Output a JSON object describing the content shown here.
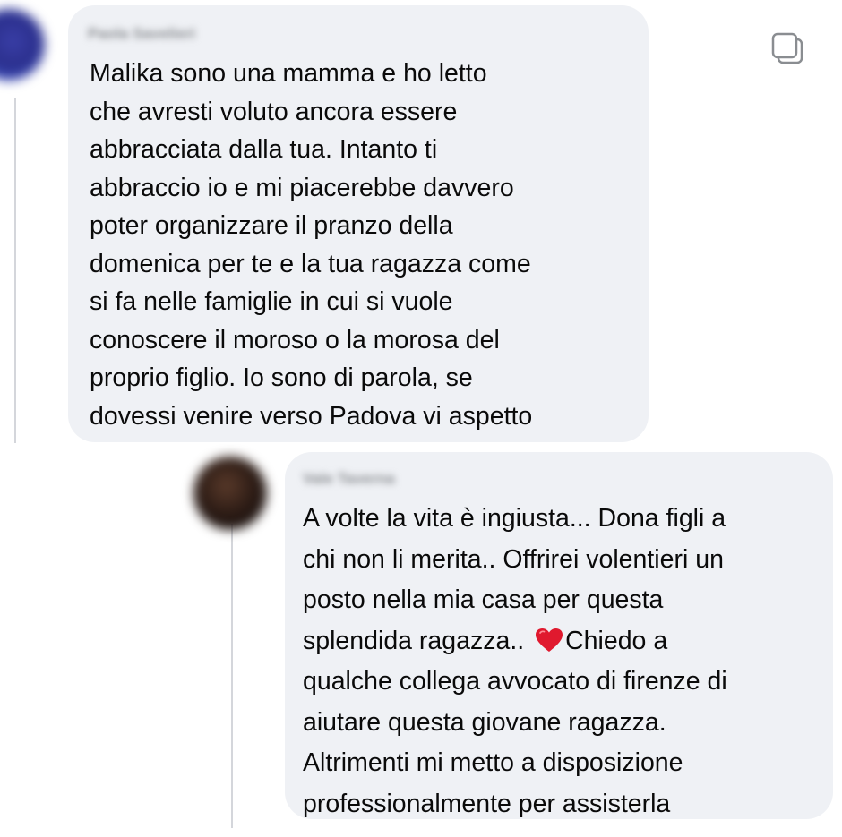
{
  "thread": {
    "comments": [
      {
        "author": "Paola Savelieri",
        "text": "Malika sono una mamma e ho letto\nche avresti voluto ancora essere\nabbracciata dalla tua. Intanto ti\nabbraccio io e mi piacerebbe davvero\npoter organizzare il pranzo della\ndomenica per te e la tua ragazza come\nsi fa nelle famiglie in cui si vuole\nconoscere il moroso o la morosa del\nproprio figlio. Io sono di parola, se\ndovessi venire verso Padova vi aspetto"
      },
      {
        "author": "Vale Taverna",
        "text_before_emoji": "A volte la vita è ingiusta... Dona figli a\nchi non li merita.. Offrirei volentieri un\nposto nella mia casa per questa\nsplendida ragazza.. ",
        "emoji": "heart-emoji",
        "text_after_emoji": "Chiedo a\nqualche collega avvocato di firenze di\naiutare questa giovane ragazza.\nAltrimenti mi metto a disposizione\nprofessionalmente per assisterla"
      }
    ]
  },
  "icons": {
    "copy": "copy-icon",
    "heart": "heart-emoji"
  },
  "colors": {
    "bubble_background": "#eff1f5",
    "thread_line": "#d4d6db",
    "text": "#0a0a0a",
    "heart": "#e0192e"
  }
}
